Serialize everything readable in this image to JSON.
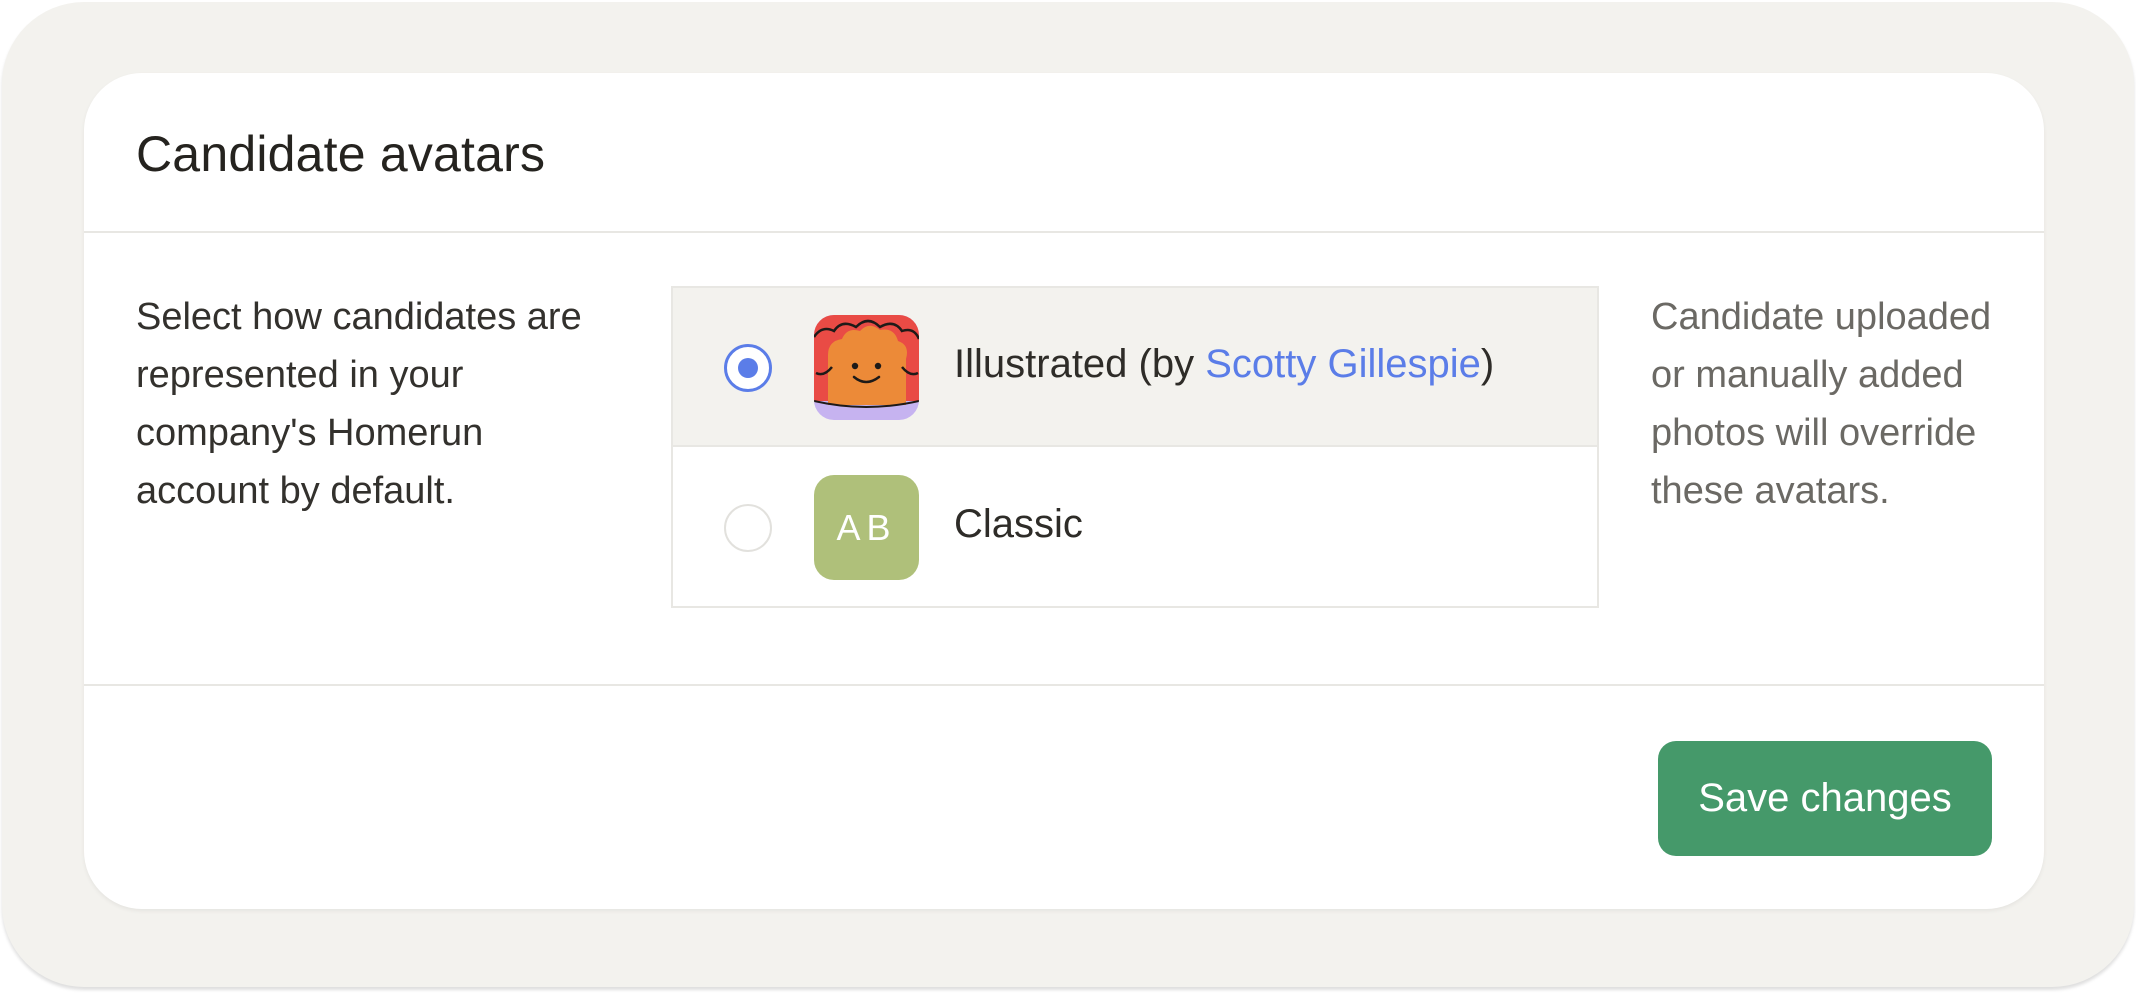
{
  "card": {
    "title": "Candidate avatars",
    "description": "Select how candidates are represented in your company's Homerun account by default.",
    "note": "Candidate uploaded or manually added photos will override these avatars."
  },
  "options": [
    {
      "label_prefix": "Illustrated (by ",
      "link_text": "Scotty Gillespie",
      "label_suffix": ")",
      "selected": true,
      "avatar_icon": "illustrated-face-icon"
    },
    {
      "label": "Classic",
      "avatar_initials": "AB",
      "selected": false
    }
  ],
  "actions": {
    "save_label": "Save changes"
  },
  "colors": {
    "accent": "#5b7de8",
    "save_button": "#45996a",
    "classic_avatar": "#afc07a",
    "background": "#f3f2ee"
  }
}
